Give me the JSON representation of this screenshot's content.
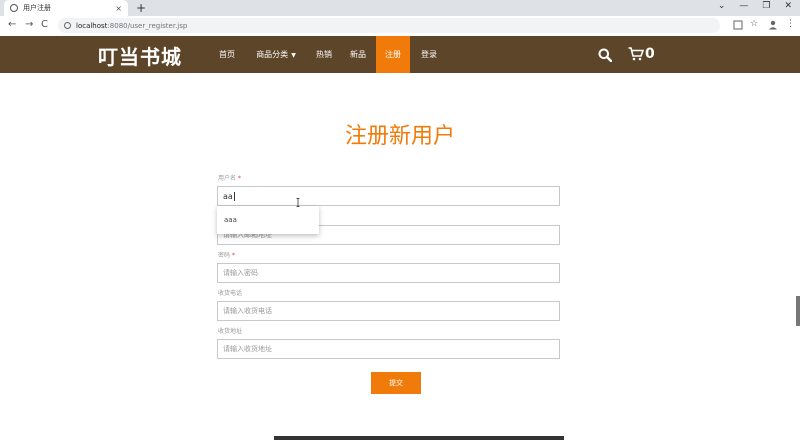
{
  "browser": {
    "tab_title": "用户注册",
    "tab_close": "×",
    "new_tab": "+",
    "window_buttons": [
      "⌄",
      "—",
      "❐",
      "✕"
    ],
    "url_host": "localhost",
    "url_path": ":8080/user_register.jsp",
    "nav": [
      "←",
      "→",
      "C"
    ]
  },
  "site": {
    "logo": "叮当书城",
    "nav_items": [
      {
        "label": "首页"
      },
      {
        "label": "商品分类"
      },
      {
        "label": "热销"
      },
      {
        "label": "新品"
      },
      {
        "label": "注册"
      },
      {
        "label": "登录"
      }
    ],
    "caret": "▼",
    "cart_count": "0",
    "active_color": "#f07b0a",
    "nav_bg": "#5c4528"
  },
  "form": {
    "title": "注册新用户",
    "username_label": "用户名",
    "required_mark": "*",
    "username_value": "aa",
    "autocomplete_option": "aaa",
    "email_placeholder": "请输入邮箱地址",
    "password_label": "密码",
    "password_placeholder": "请输入密码",
    "phone_label": "收货电话",
    "phone_placeholder": "请输入收货电话",
    "address_label": "收货地址",
    "address_placeholder": "请输入收货地址",
    "submit_label": "提交"
  }
}
